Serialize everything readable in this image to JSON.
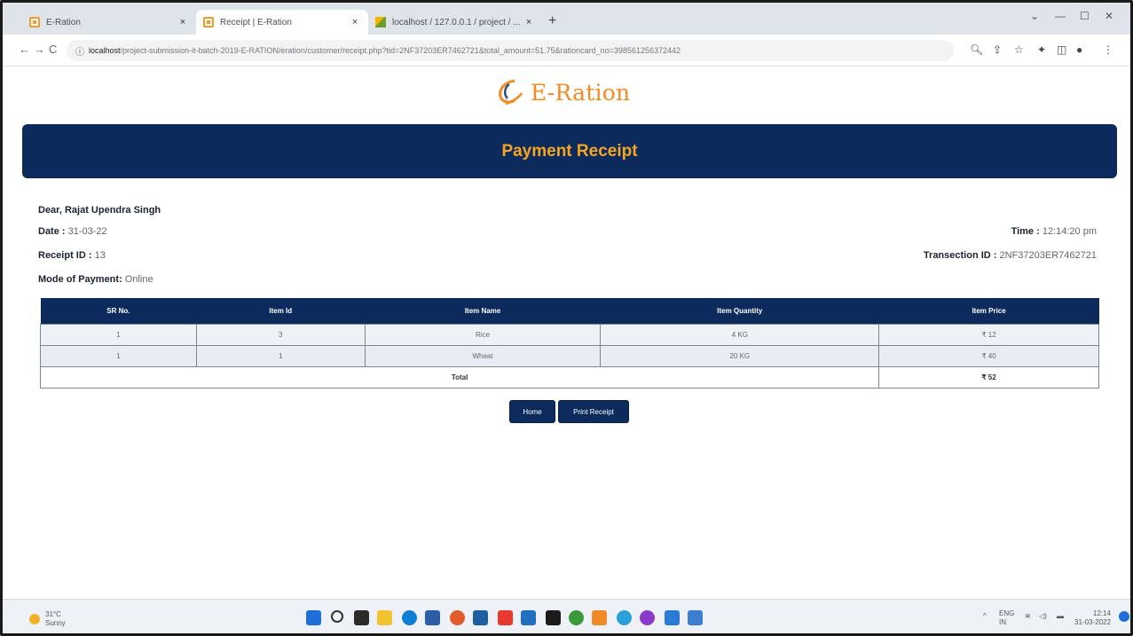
{
  "browser": {
    "tabs": [
      {
        "label": "E-Ration",
        "close": "×"
      },
      {
        "label": "Receipt | E-Ration",
        "close": "×"
      },
      {
        "label": "localhost / 127.0.0.1 / project / ...",
        "close": "×"
      }
    ],
    "new_tab": "+",
    "window_controls": {
      "dropdown": "⌄",
      "minimize": "—",
      "maximize": "☐",
      "close": "✕"
    },
    "nav": {
      "back": "←",
      "forward": "→",
      "reload": "C"
    },
    "url_host": "localhost",
    "url_rest": "/project-submission-it-batch-2019-E-RATION/eration/customer/receipt.php?tid=2NF37203ER7462721&total_amount=51.75&rationcard_no=398561256372442"
  },
  "page": {
    "brand": "E-Ration",
    "banner_title": "Payment Receipt",
    "greeting": "Dear, Rajat Upendra Singh",
    "date_label": "Date :",
    "date_value": "31-03-22",
    "receipt_label": "Receipt ID :",
    "receipt_value": "13",
    "mode_label": "Mode of Payment:",
    "mode_value": "Online",
    "time_label": "Time :",
    "time_value": "12:14:20 pm",
    "txn_label": "Transection ID :",
    "txn_value": "2NF37203ER7462721",
    "table": {
      "headers": [
        "SR No.",
        "Item Id",
        "Item Name",
        "Item Quantity",
        "Item Price"
      ],
      "rows": [
        [
          "1",
          "3",
          "Rice",
          "4 KG",
          "₹ 12"
        ],
        [
          "1",
          "1",
          "Wheat",
          "20 KG",
          "₹ 40"
        ]
      ],
      "total_label": "Total",
      "total_value": "₹ 52"
    },
    "buttons": {
      "home": "Home",
      "print": "Print Receipt"
    }
  },
  "taskbar": {
    "weather_temp": "31°C",
    "weather_desc": "Sunny",
    "lang": "ENG",
    "region": "IN",
    "time": "12:14",
    "date": "31-03-2022"
  }
}
